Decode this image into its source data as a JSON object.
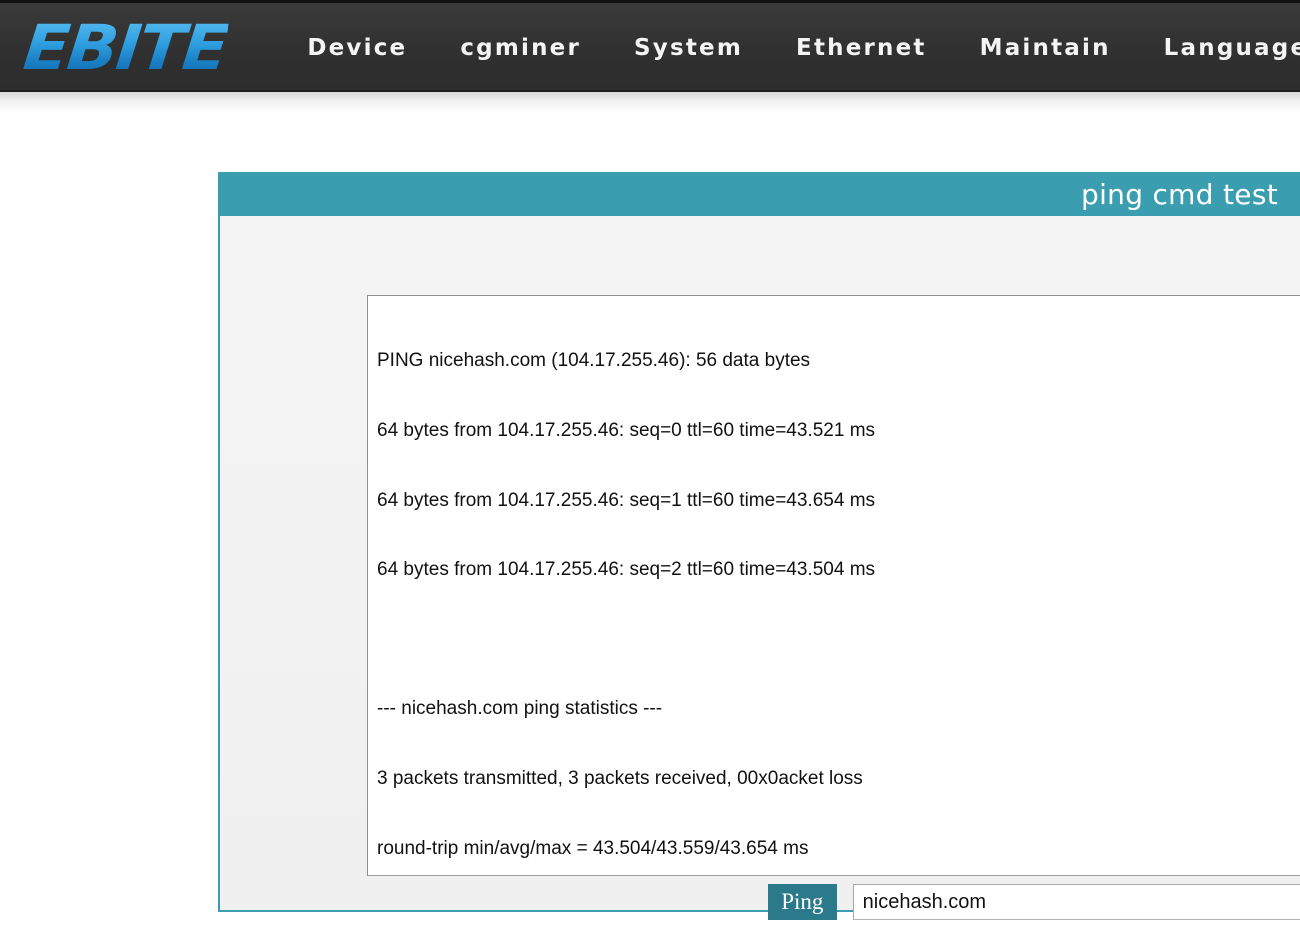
{
  "brand": {
    "logo_text": "EBITE",
    "logo_color": "#2f9fe0"
  },
  "nav": {
    "items": [
      {
        "label": "Device"
      },
      {
        "label": "cgminer"
      },
      {
        "label": "System"
      },
      {
        "label": "Ethernet"
      },
      {
        "label": "Maintain"
      },
      {
        "label": "Language"
      }
    ]
  },
  "panel": {
    "title": "ping cmd test",
    "header_color": "#3a9eb0",
    "border_color": "#3a9eb0",
    "body_color": "#f2f2f2"
  },
  "output": {
    "lines": [
      "PING nicehash.com (104.17.255.46): 56 data bytes",
      "64 bytes from 104.17.255.46: seq=0 ttl=60 time=43.521 ms",
      "64 bytes from 104.17.255.46: seq=1 ttl=60 time=43.654 ms",
      "64 bytes from 104.17.255.46: seq=2 ttl=60 time=43.504 ms",
      "",
      "--- nicehash.com ping statistics ---",
      "3 packets transmitted, 3 packets received, 00x0acket loss",
      "round-trip min/avg/max = 43.504/43.559/43.654 ms"
    ],
    "text": "PING nicehash.com (104.17.255.46): 56 data bytes\n64 bytes from 104.17.255.46: seq=0 ttl=60 time=43.521 ms\n64 bytes from 104.17.255.46: seq=1 ttl=60 time=43.654 ms\n64 bytes from 104.17.255.46: seq=2 ttl=60 time=43.504 ms\n\n--- nicehash.com ping statistics ---\n3 packets transmitted, 3 packets received, 00x0acket loss\nround-trip min/avg/max = 43.504/43.559/43.654 ms"
  },
  "controls": {
    "ping_button_label": "Ping",
    "ping_button_color": "#2b7a8c",
    "host_value": "nicehash.com",
    "host_placeholder": "nicehash.com"
  }
}
